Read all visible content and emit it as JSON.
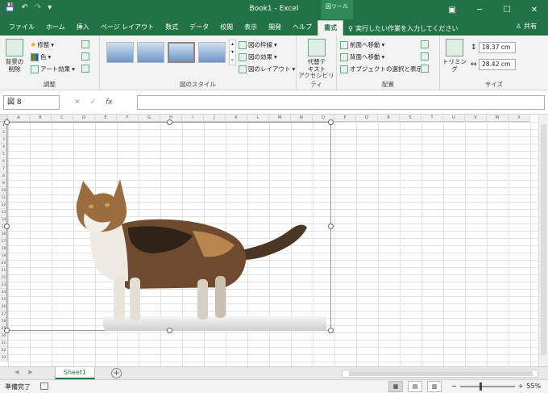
{
  "titlebar": {
    "title": "Book1  -  Excel",
    "context_tab_group": "図ツール",
    "qat_icons": [
      "save-icon",
      "undo-icon",
      "redo-icon",
      "customize-icon"
    ],
    "window_buttons": [
      "ribbon-options-icon",
      "minimize-icon",
      "restore-icon",
      "close-icon"
    ]
  },
  "tabs": {
    "items": [
      "ファイル",
      "ホーム",
      "挿入",
      "ページ レイアウト",
      "数式",
      "データ",
      "校閲",
      "表示",
      "開発",
      "ヘルプ",
      "書式"
    ],
    "active": "書式",
    "tell_me": "実行したい作業を入力してください",
    "share": "共有"
  },
  "ribbon": {
    "adjust": {
      "label": "調整",
      "remove_bg": "背景の\n削除",
      "corrections": "修整",
      "color": "色",
      "art_effects": "アート効果"
    },
    "styles": {
      "label": "図のスタイル",
      "border": "図の枠線",
      "effects": "図の効果",
      "layout": "図のレイアウト"
    },
    "accessibility": {
      "label": "アクセシビリティ",
      "alt_text": "代替テ\nキスト"
    },
    "arrange": {
      "label": "配置",
      "bring_forward": "前面へ移動",
      "send_backward": "背面へ移動",
      "selection_pane": "オブジェクトの選択と表示"
    },
    "size": {
      "label": "サイズ",
      "crop": "トリミング",
      "height": "18.37 cm",
      "width": "28.42 cm"
    }
  },
  "formula_bar": {
    "name_box": "図 8",
    "cancel": "✕",
    "enter": "✓",
    "fx": "fx",
    "content": ""
  },
  "sheet": {
    "columns": [
      "A",
      "B",
      "C",
      "D",
      "E",
      "F",
      "G",
      "H",
      "I",
      "J",
      "K",
      "L",
      "M",
      "N",
      "O",
      "P",
      "Q",
      "R",
      "S",
      "T",
      "U",
      "V",
      "W",
      "X"
    ],
    "rows": [
      "1",
      "2",
      "3",
      "4",
      "5",
      "6",
      "7",
      "8",
      "9",
      "10",
      "11",
      "12",
      "13",
      "14",
      "15",
      "16",
      "17",
      "18",
      "19",
      "20",
      "21",
      "22",
      "23",
      "24",
      "25",
      "26",
      "27",
      "28",
      "29",
      "30",
      "31",
      "32",
      "33"
    ]
  },
  "sheet_tabs": {
    "items": [
      "Sheet1"
    ],
    "active": "Sheet1"
  },
  "status": {
    "ready": "準備完了",
    "zoom": "55%",
    "zoom_minus": "−",
    "zoom_plus": "+"
  },
  "colors": {
    "excel_green": "#217346",
    "ribbon_bg": "#f3f3f3"
  }
}
